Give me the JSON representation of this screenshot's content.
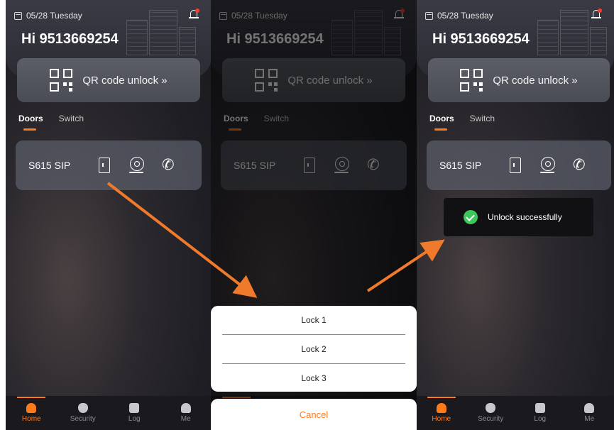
{
  "screen": {
    "date": "05/28 Tuesday",
    "greeting": "Hi 9513669254",
    "qr_label": "QR code unlock »",
    "tabs": [
      "Doors",
      "Switch"
    ],
    "door_name": "S615 SIP",
    "nav": [
      "Home",
      "Security",
      "Log",
      "Me"
    ]
  },
  "sheet": {
    "options": [
      "Lock 1",
      "Lock 2",
      "Lock 3"
    ],
    "cancel": "Cancel"
  },
  "toast": {
    "text": "Unlock successfully",
    "icon": "check-circle-icon"
  },
  "colors": {
    "accent": "#ff7a1a",
    "arrow": "#f07a2b",
    "success": "#3cc85a"
  }
}
